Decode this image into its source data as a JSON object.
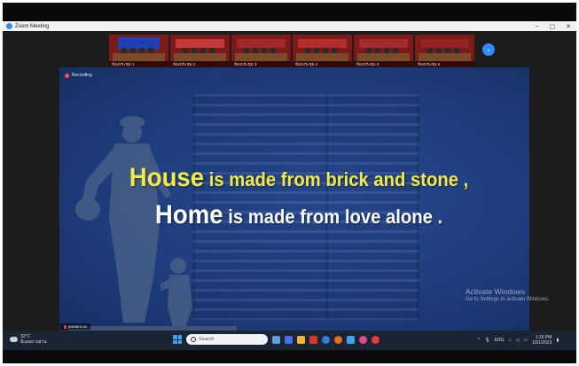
{
  "window": {
    "title": "Zoom Meeting",
    "controls": [
      "–",
      "▢",
      "✕"
    ]
  },
  "thumbnails": [
    {
      "name": "ห้องประชุม 1",
      "banner_color": "#1f3fb3"
    },
    {
      "name": "ห้องประชุม 2",
      "banner_color": "#c43a3a"
    },
    {
      "name": "ห้องประชุม 3",
      "banner_color": "#8a1b1b"
    },
    {
      "name": "ห้องประชุม 4",
      "banner_color": "#9b1e1e"
    },
    {
      "name": "ห้องประชุม 5",
      "banner_color": "#8d1e22"
    },
    {
      "name": "ห้องประชุม 6",
      "banner_color": "#7a1818"
    }
  ],
  "nav": {
    "next_icon": "›"
  },
  "share": {
    "recording_label": "Recording",
    "quote_line1_big": "House",
    "quote_line1_rest": " is made from brick and stone ,",
    "quote_line2_big": "Home",
    "quote_line2_rest": " is made from love alone .",
    "presenter_label": "present ax"
  },
  "watermark": {
    "title": "Activate Windows",
    "subtitle": "Go to Settings to activate Windows."
  },
  "taskbar": {
    "temperature": "32°C",
    "weather_desc": "มีเมฆบางส่วน",
    "search_placeholder": "Search",
    "apps": [
      "#5aa0e0",
      "#4b6cf0",
      "#f2b53a",
      "#e0332b",
      "#2b7de0",
      "#e86c1e",
      "#3ea6f0",
      "#e04a8a",
      "#e63b3b"
    ],
    "language": "ENG",
    "time": "1:16 PM",
    "date": "10/1/2023"
  },
  "colors": {
    "quote_highlight": "#f3e94a",
    "slide_background": "#1f3d7e",
    "zoom_blue": "#2d8cff"
  }
}
